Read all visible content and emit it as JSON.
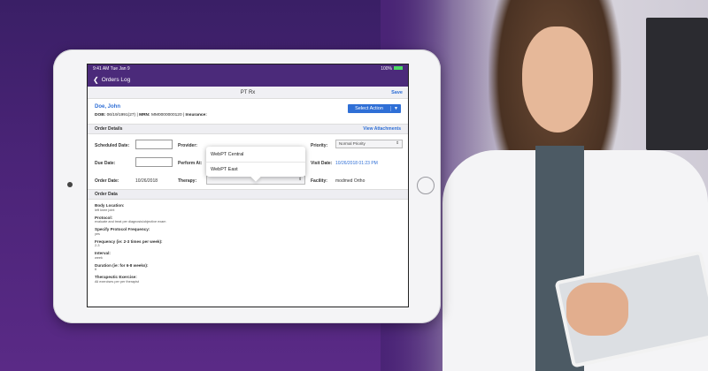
{
  "status": {
    "time": "9:41 AM  Tue Jan 9",
    "battery": "100%"
  },
  "nav": {
    "back_label": "Orders Log"
  },
  "titlebar": {
    "title": "PT Rx",
    "save_label": "Save"
  },
  "patient": {
    "name": "Doe, John",
    "dob_label": "DOB:",
    "dob_value": "06/19/1991(27)",
    "mrn_label": "MRN:",
    "mrn_value": "MM0000000120",
    "insurance_label": "Insurance:"
  },
  "select_action": {
    "label": "Select Action"
  },
  "order_details": {
    "title": "Order Details",
    "link": "View Attachments",
    "scheduled_date_label": "Scheduled Date:",
    "due_date_label": "Due Date:",
    "order_date_label": "Order Date:",
    "order_date_value": "10/26/2018",
    "provider_label": "Provider:",
    "perform_at_label": "Perform At:",
    "therapy_label": "Therapy:",
    "priority_label": "Priority:",
    "priority_value": "Normal Priority",
    "visit_date_label": "Visit Date:",
    "visit_date_value": "10/26/2018 01:23 PM",
    "facility_label": "Facility:",
    "facility_value": "modmed Ortho"
  },
  "provider_options": [
    "WebPT Central",
    "WebPT East"
  ],
  "order_data": {
    "title": "Order Data",
    "fields": [
      {
        "label": "Body Location:",
        "value": "left knee joint"
      },
      {
        "label": "Protocol:",
        "value": "evaluate and treat per diagnosis/objective exam"
      },
      {
        "label": "Specify Protocol Frequency:",
        "value": "yes"
      },
      {
        "label": "Frequency (ie: 2-3 times per week):",
        "value": "2-3"
      },
      {
        "label": "Interval:",
        "value": "week"
      },
      {
        "label": "Duration (ie: for 6-8 weeks):",
        "value": "6"
      },
      {
        "label": "Therapeutic Exercise:",
        "value": "All exercises per per therapist"
      }
    ]
  },
  "colors": {
    "accent": "#2f6fd6",
    "brand": "#4b2a7a"
  },
  "icons": [
    "back-chevron-icon",
    "caret-down-icon",
    "battery-icon"
  ]
}
